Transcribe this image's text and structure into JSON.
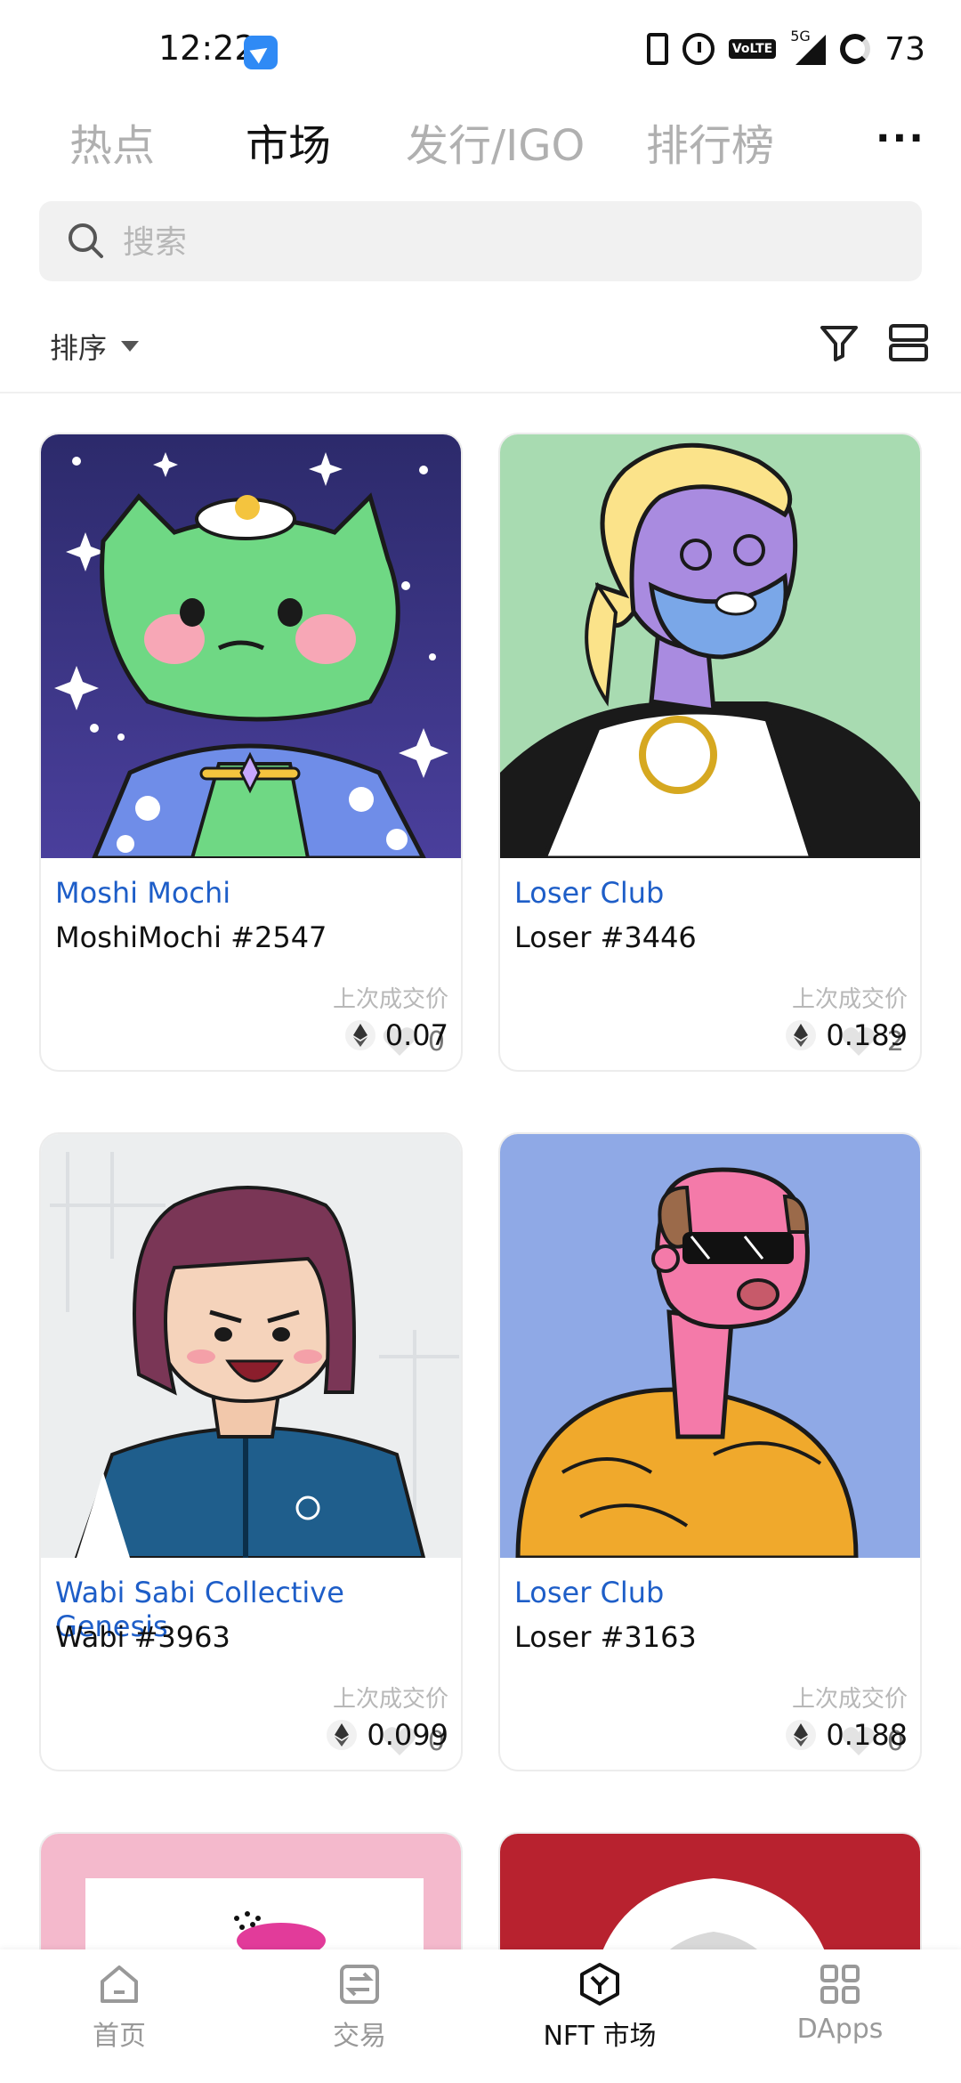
{
  "status": {
    "time": "12:22",
    "network": "5G",
    "volte": "VoLTE",
    "battery": "73"
  },
  "tabs": [
    {
      "label": "热点",
      "active": false
    },
    {
      "label": "市场",
      "active": true
    },
    {
      "label": "发行/IGO",
      "active": false
    },
    {
      "label": "排行榜",
      "active": false
    }
  ],
  "more_label": "···",
  "search": {
    "placeholder": "搜索",
    "value": ""
  },
  "sort": {
    "label": "排序"
  },
  "cards": [
    {
      "collection": "Moshi Mochi",
      "token": "MoshiMochi #2547",
      "likes": "0",
      "price_label": "上次成交价",
      "price": "0.07",
      "image": "green-cat-nft"
    },
    {
      "collection": "Loser Club",
      "token": "Loser #3446",
      "likes": "2",
      "price_label": "上次成交价",
      "price": "0.189",
      "image": "purple-face-nft"
    },
    {
      "collection": "Wabi Sabi Collective Genesis",
      "token": "Wabi #3963",
      "likes": "0",
      "price_label": "上次成交价",
      "price": "0.099",
      "image": "girl-jacket-nft"
    },
    {
      "collection": "Loser Club",
      "token": "Loser #3163",
      "likes": "0",
      "price_label": "上次成交价",
      "price": "0.188",
      "image": "pink-sunglasses-nft"
    }
  ],
  "nav": [
    {
      "label": "首页",
      "icon": "home-icon"
    },
    {
      "label": "交易",
      "icon": "trade-icon"
    },
    {
      "label": "NFT 市场",
      "icon": "nft-icon"
    },
    {
      "label": "DApps",
      "icon": "dapps-icon"
    }
  ],
  "colors": {
    "accent": "#1e5ec8",
    "muted": "#b7b7b7"
  }
}
